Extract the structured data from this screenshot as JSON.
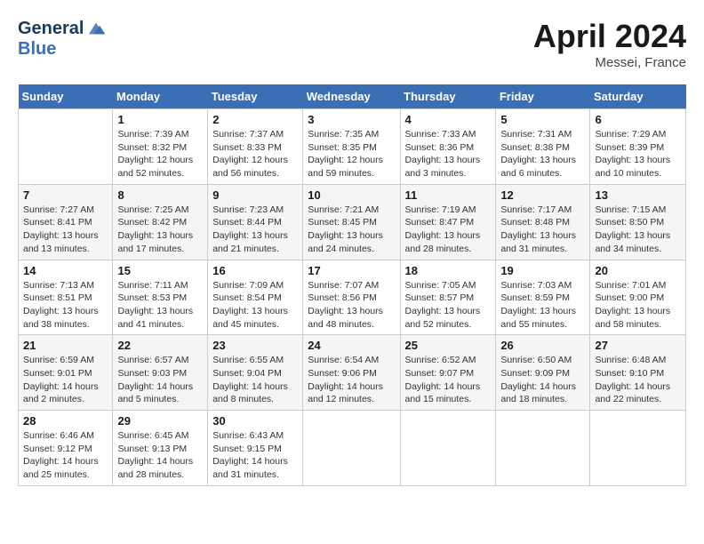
{
  "header": {
    "logo_line1": "General",
    "logo_line2": "Blue",
    "month_year": "April 2024",
    "location": "Messei, France"
  },
  "days_of_week": [
    "Sunday",
    "Monday",
    "Tuesday",
    "Wednesday",
    "Thursday",
    "Friday",
    "Saturday"
  ],
  "weeks": [
    [
      {
        "day": "",
        "info": ""
      },
      {
        "day": "1",
        "info": "Sunrise: 7:39 AM\nSunset: 8:32 PM\nDaylight: 12 hours\nand 52 minutes."
      },
      {
        "day": "2",
        "info": "Sunrise: 7:37 AM\nSunset: 8:33 PM\nDaylight: 12 hours\nand 56 minutes."
      },
      {
        "day": "3",
        "info": "Sunrise: 7:35 AM\nSunset: 8:35 PM\nDaylight: 12 hours\nand 59 minutes."
      },
      {
        "day": "4",
        "info": "Sunrise: 7:33 AM\nSunset: 8:36 PM\nDaylight: 13 hours\nand 3 minutes."
      },
      {
        "day": "5",
        "info": "Sunrise: 7:31 AM\nSunset: 8:38 PM\nDaylight: 13 hours\nand 6 minutes."
      },
      {
        "day": "6",
        "info": "Sunrise: 7:29 AM\nSunset: 8:39 PM\nDaylight: 13 hours\nand 10 minutes."
      }
    ],
    [
      {
        "day": "7",
        "info": "Sunrise: 7:27 AM\nSunset: 8:41 PM\nDaylight: 13 hours\nand 13 minutes."
      },
      {
        "day": "8",
        "info": "Sunrise: 7:25 AM\nSunset: 8:42 PM\nDaylight: 13 hours\nand 17 minutes."
      },
      {
        "day": "9",
        "info": "Sunrise: 7:23 AM\nSunset: 8:44 PM\nDaylight: 13 hours\nand 21 minutes."
      },
      {
        "day": "10",
        "info": "Sunrise: 7:21 AM\nSunset: 8:45 PM\nDaylight: 13 hours\nand 24 minutes."
      },
      {
        "day": "11",
        "info": "Sunrise: 7:19 AM\nSunset: 8:47 PM\nDaylight: 13 hours\nand 28 minutes."
      },
      {
        "day": "12",
        "info": "Sunrise: 7:17 AM\nSunset: 8:48 PM\nDaylight: 13 hours\nand 31 minutes."
      },
      {
        "day": "13",
        "info": "Sunrise: 7:15 AM\nSunset: 8:50 PM\nDaylight: 13 hours\nand 34 minutes."
      }
    ],
    [
      {
        "day": "14",
        "info": "Sunrise: 7:13 AM\nSunset: 8:51 PM\nDaylight: 13 hours\nand 38 minutes."
      },
      {
        "day": "15",
        "info": "Sunrise: 7:11 AM\nSunset: 8:53 PM\nDaylight: 13 hours\nand 41 minutes."
      },
      {
        "day": "16",
        "info": "Sunrise: 7:09 AM\nSunset: 8:54 PM\nDaylight: 13 hours\nand 45 minutes."
      },
      {
        "day": "17",
        "info": "Sunrise: 7:07 AM\nSunset: 8:56 PM\nDaylight: 13 hours\nand 48 minutes."
      },
      {
        "day": "18",
        "info": "Sunrise: 7:05 AM\nSunset: 8:57 PM\nDaylight: 13 hours\nand 52 minutes."
      },
      {
        "day": "19",
        "info": "Sunrise: 7:03 AM\nSunset: 8:59 PM\nDaylight: 13 hours\nand 55 minutes."
      },
      {
        "day": "20",
        "info": "Sunrise: 7:01 AM\nSunset: 9:00 PM\nDaylight: 13 hours\nand 58 minutes."
      }
    ],
    [
      {
        "day": "21",
        "info": "Sunrise: 6:59 AM\nSunset: 9:01 PM\nDaylight: 14 hours\nand 2 minutes."
      },
      {
        "day": "22",
        "info": "Sunrise: 6:57 AM\nSunset: 9:03 PM\nDaylight: 14 hours\nand 5 minutes."
      },
      {
        "day": "23",
        "info": "Sunrise: 6:55 AM\nSunset: 9:04 PM\nDaylight: 14 hours\nand 8 minutes."
      },
      {
        "day": "24",
        "info": "Sunrise: 6:54 AM\nSunset: 9:06 PM\nDaylight: 14 hours\nand 12 minutes."
      },
      {
        "day": "25",
        "info": "Sunrise: 6:52 AM\nSunset: 9:07 PM\nDaylight: 14 hours\nand 15 minutes."
      },
      {
        "day": "26",
        "info": "Sunrise: 6:50 AM\nSunset: 9:09 PM\nDaylight: 14 hours\nand 18 minutes."
      },
      {
        "day": "27",
        "info": "Sunrise: 6:48 AM\nSunset: 9:10 PM\nDaylight: 14 hours\nand 22 minutes."
      }
    ],
    [
      {
        "day": "28",
        "info": "Sunrise: 6:46 AM\nSunset: 9:12 PM\nDaylight: 14 hours\nand 25 minutes."
      },
      {
        "day": "29",
        "info": "Sunrise: 6:45 AM\nSunset: 9:13 PM\nDaylight: 14 hours\nand 28 minutes."
      },
      {
        "day": "30",
        "info": "Sunrise: 6:43 AM\nSunset: 9:15 PM\nDaylight: 14 hours\nand 31 minutes."
      },
      {
        "day": "",
        "info": ""
      },
      {
        "day": "",
        "info": ""
      },
      {
        "day": "",
        "info": ""
      },
      {
        "day": "",
        "info": ""
      }
    ]
  ]
}
